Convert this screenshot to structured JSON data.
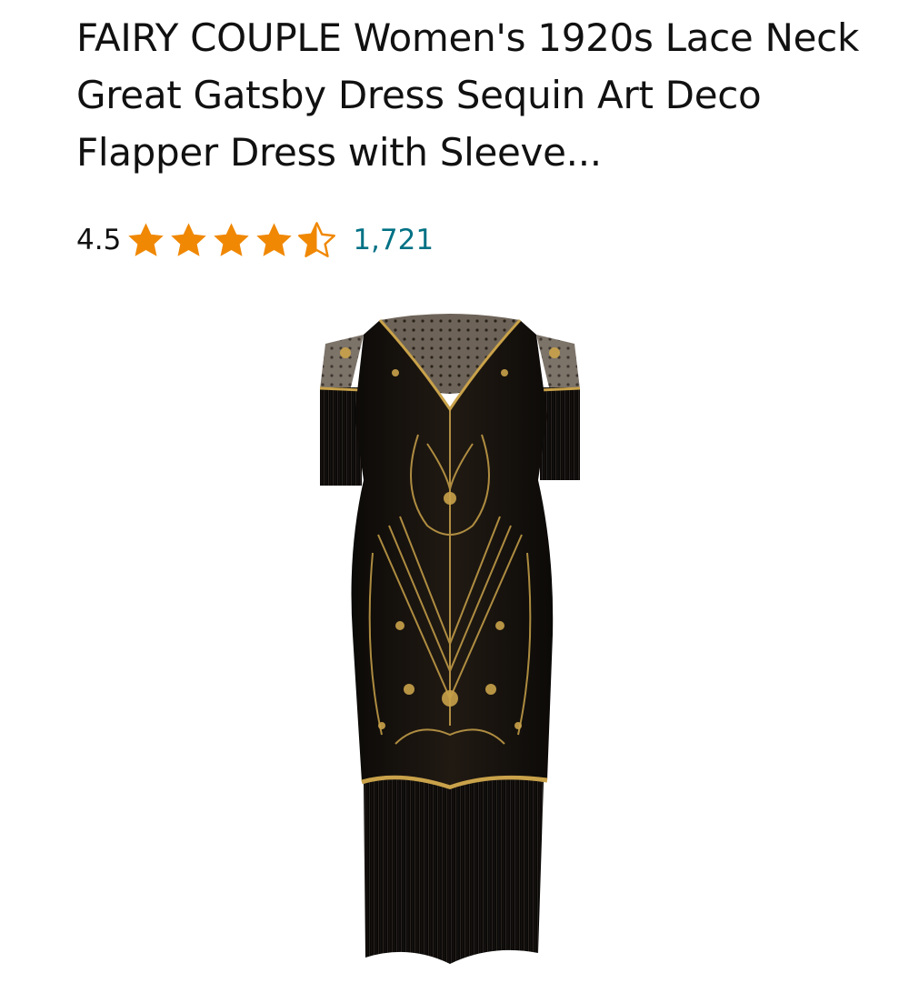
{
  "product": {
    "title": "FAIRY COUPLE Women's 1920s Lace Neck Great Gatsby Dress Sequin Art Deco Flapper Dress with Sleeve...",
    "rating_value": "4.5",
    "rating_stars": 4.5,
    "rating_max": 5,
    "review_count": "1,721",
    "image_icon": "flapper-dress-image"
  },
  "colors": {
    "star": "#f08804",
    "link": "#007185",
    "text": "#111111",
    "dress": "#1a1410",
    "gold": "#c9a24a"
  }
}
